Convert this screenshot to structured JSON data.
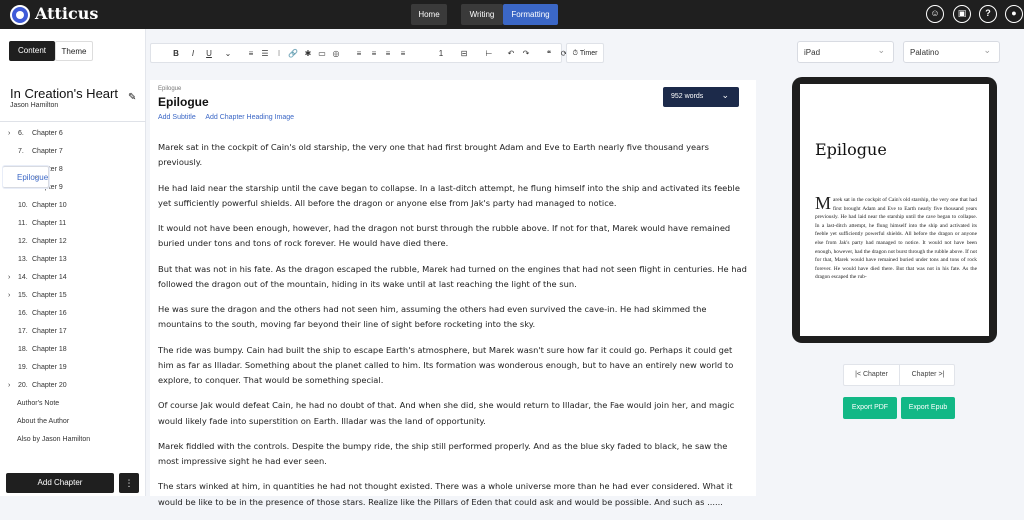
{
  "app": {
    "name": "Atticus"
  },
  "header": {
    "nav": [
      "Home",
      "Writing",
      "Formatting"
    ],
    "icons": [
      "chat-icon",
      "calendar-icon",
      "help-icon",
      "user-icon"
    ]
  },
  "sidebar": {
    "tabs": [
      "Content",
      "Theme"
    ],
    "book_title": "In Creation's Heart",
    "author": "Jason Hamilton",
    "chapters": [
      {
        "label": "Chapter 6",
        "num": "6.",
        "expandable": true
      },
      {
        "label": "Chapter 7",
        "num": "7.",
        "expandable": false
      },
      {
        "label": "Chapter 8",
        "num": "8.",
        "expandable": true
      },
      {
        "label": "Chapter 9",
        "num": "9.",
        "expandable": true
      },
      {
        "label": "Chapter 10",
        "num": "10.",
        "expandable": false
      },
      {
        "label": "Chapter 11",
        "num": "11.",
        "expandable": false
      },
      {
        "label": "Chapter 12",
        "num": "12.",
        "expandable": false
      },
      {
        "label": "Chapter 13",
        "num": "13.",
        "expandable": false
      },
      {
        "label": "Chapter 14",
        "num": "14.",
        "expandable": true
      },
      {
        "label": "Chapter 15",
        "num": "15.",
        "expandable": true
      },
      {
        "label": "Chapter 16",
        "num": "16.",
        "expandable": false
      },
      {
        "label": "Chapter 17",
        "num": "17.",
        "expandable": false
      },
      {
        "label": "Chapter 18",
        "num": "18.",
        "expandable": false
      },
      {
        "label": "Chapter 19",
        "num": "19.",
        "expandable": false
      },
      {
        "label": "Chapter 20",
        "num": "20.",
        "expandable": true
      }
    ],
    "backmatter": [
      "Epilogue",
      "Author's Note",
      "About the Author",
      "Also by Jason Hamilton"
    ],
    "selected": "Epilogue",
    "add_chapter": "Add Chapter",
    "more": "⋮"
  },
  "toolbar": {
    "items": [
      "B",
      "I",
      "U",
      "⌄",
      "≡",
      "☰",
      "⁝",
      "🔗",
      "✱",
      "▭",
      "◎",
      "≡",
      "≡",
      "≡",
      "≡",
      "1",
      "⊟",
      "⊢",
      "↶",
      "↷",
      "❝",
      "⟳"
    ],
    "timer": "Timer"
  },
  "editor": {
    "kind": "Epilogue",
    "title": "Epilogue",
    "add_subtitle": "Add Subtitle",
    "add_heading_image": "Add Chapter Heading Image",
    "word_count": "952 words",
    "paragraphs": [
      "Marek sat in the cockpit of Cain's old starship, the very one that had first brought Adam and Eve to Earth nearly five thousand years previously.",
      "He had laid near the starship until the cave began to collapse. In a last-ditch attempt, he flung himself into the ship and activated its feeble yet sufficiently powerful shields. All before the dragon or anyone else from Jak's party had managed to notice.",
      "It would not have been enough, however, had the dragon not burst through the rubble above. If not for that, Marek would have remained buried under tons and tons of rock forever. He would have died there.",
      "But that was not in his fate. As the dragon escaped the rubble, Marek had turned on the engines that had not seen flight in centuries. He had followed the dragon out of the mountain, hiding in its wake until at last reaching the light of the sun.",
      "He was sure the dragon and the others had not seen him, assuming the others had even survived the cave-in. He had skimmed the mountains to the south, moving far beyond their line of sight before rocketing into the sky.",
      "The ride was bumpy. Cain had built the ship to escape Earth's atmosphere, but Marek wasn't sure how far it could go. Perhaps it could get him as far as Illadar. Something about the planet called to him. Its formation was wonderous enough, but to have an entirely new world to explore, to conquer. That would be something special.",
      "Of course Jak would defeat Cain, he had no doubt of that. And when she did, she would return to Illadar, the Fae would join her, and magic would likely fade into superstition on Earth. Illadar was the land of opportunity.",
      "Marek fiddled with the controls. Despite the bumpy ride, the ship still performed properly. And as the blue sky faded to black, he saw the most impressive sight he had ever seen.",
      "The stars winked at him, in quantities he had not thought existed. There was a whole universe more than he had ever considered. What it would be like to be in the presence of those stars. Realize like the Pillars of Eden that could ask and would be possible. And such as ......"
    ]
  },
  "preview": {
    "device": "iPad",
    "font": "Palatino",
    "title": "Epilogue",
    "drop_cap": "M",
    "text": "arek sat in the cockpit of Cain's old starship, the very one that had first brought Adam and Eve to Earth nearly five thousand years previously. He had laid near the starship until the cave began to collapse. In a last-ditch attempt, he flung himself into the ship and activated its feeble yet sufficiently powerful shields. All before the dragon or anyone else from Jak's party had managed to notice. It would not have been enough, however, had the dragon not burst through the rubble above. If not for that, Marek would have remained buried under tons and tons of rock forever. He would have died there. But that was not in his fate. As the dragon escaped the rub-",
    "prev_chapter": "Chapter",
    "next_chapter": "Chapter",
    "export_pdf": "Export PDF",
    "export_epub": "Export Epub"
  }
}
